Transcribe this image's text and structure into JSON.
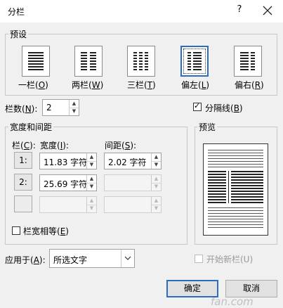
{
  "window": {
    "title": "分栏",
    "help": "?",
    "close_icon": "close-icon"
  },
  "presets": {
    "group_label": "预设",
    "items": [
      {
        "label": "一栏(",
        "key": "O",
        "suffix": ")"
      },
      {
        "label": "两栏(",
        "key": "W",
        "suffix": ")"
      },
      {
        "label": "三栏(",
        "key": "T",
        "suffix": ")"
      },
      {
        "label": "偏左(",
        "key": "L",
        "suffix": ")"
      },
      {
        "label": "偏右(",
        "key": "R",
        "suffix": ")"
      }
    ],
    "selected": "偏左"
  },
  "columns": {
    "label": "栏数(",
    "key": "N",
    "suffix": "):",
    "value": "2"
  },
  "separator": {
    "label": "分隔线(",
    "key": "B",
    "suffix": ")",
    "checked": true
  },
  "width_spacing": {
    "group_label": "宽度和间距",
    "col_header": {
      "label": "栏(",
      "key": "C",
      "suffix": "):"
    },
    "width_header": {
      "label": "宽度(",
      "key": "I",
      "suffix": "):"
    },
    "spacing_header": {
      "label": "间距(",
      "key": "S",
      "suffix": "):"
    },
    "rows": [
      {
        "num": "1:",
        "width": "11.83 字符",
        "spacing": "2.02 字符"
      },
      {
        "num": "2:",
        "width": "25.69 字符",
        "spacing": ""
      },
      {
        "num": "",
        "width": "",
        "spacing": ""
      }
    ],
    "equal_width": {
      "label": "栏宽相等(",
      "key": "E",
      "suffix": ")",
      "checked": false
    }
  },
  "preview": {
    "group_label": "预览"
  },
  "apply_to": {
    "label": "应用于(",
    "key": "A",
    "suffix": "):",
    "value": "所选文字"
  },
  "new_column": {
    "label": "开始新栏(U)",
    "checked": false,
    "disabled": true
  },
  "buttons": {
    "ok": "确定",
    "cancel": "取消"
  },
  "watermark": "fan.com"
}
